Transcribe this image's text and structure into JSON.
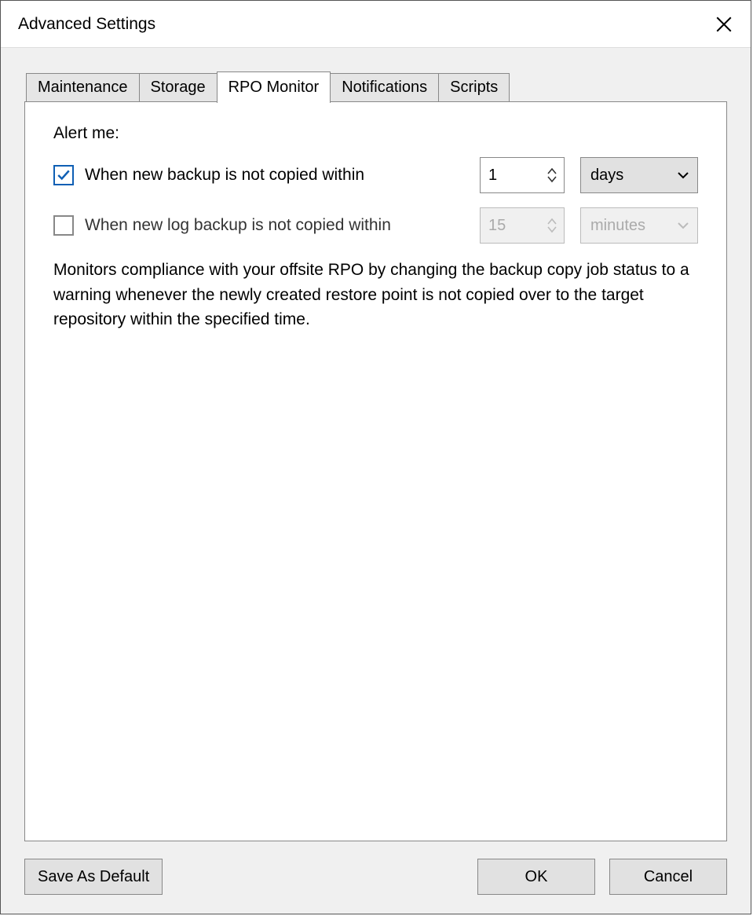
{
  "dialog": {
    "title": "Advanced Settings"
  },
  "tabs": {
    "maintenance": "Maintenance",
    "storage": "Storage",
    "rpo_monitor": "RPO Monitor",
    "notifications": "Notifications",
    "scripts": "Scripts",
    "active": "rpo_monitor"
  },
  "rpo": {
    "group_label": "Alert me:",
    "backup": {
      "checked": true,
      "label": "When new backup is not copied within",
      "value": "1",
      "unit": "days"
    },
    "log_backup": {
      "checked": false,
      "label": "When new log backup is not copied within",
      "value": "15",
      "unit": "minutes"
    },
    "description": "Monitors compliance with your offsite RPO by changing the backup copy job status to a warning whenever the newly created restore point is not copied over to the target repository within the specified time."
  },
  "footer": {
    "save_default": "Save As Default",
    "ok": "OK",
    "cancel": "Cancel"
  }
}
